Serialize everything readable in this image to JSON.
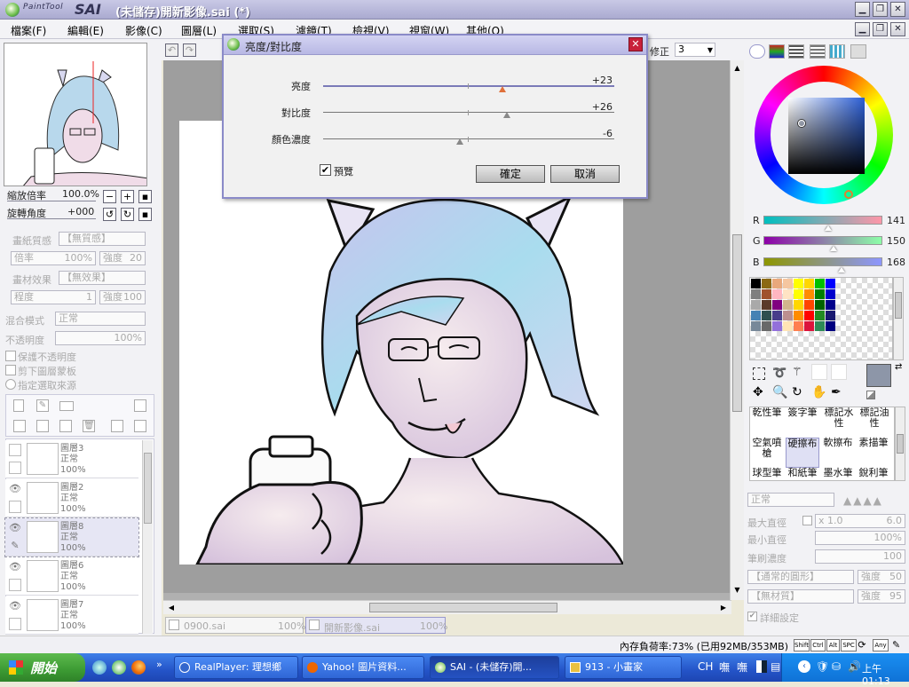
{
  "app": {
    "logo_text": "PaintTool",
    "logo_sai": "SAI",
    "window_title": "(未儲存)開新影像.sai (*)"
  },
  "menu": [
    "檔案(F)",
    "編輯(E)",
    "影像(C)",
    "圖層(L)",
    "選取(S)",
    "濾鏡(T)",
    "檢視(V)",
    "視窗(W)",
    "其他(O)"
  ],
  "toolbar": {
    "correction_label": "修正",
    "correction_value": "3"
  },
  "navigator": {
    "zoom_label": "縮放倍率",
    "zoom_value": "100.0%",
    "rotate_label": "旋轉角度",
    "rotate_value": "+000"
  },
  "paper": {
    "texture_label": "畫紙質感",
    "texture_value": "【無質感】",
    "scale_label": "倍率",
    "scale_value": "100%",
    "strength_label": "強度",
    "strength_value": "20",
    "effect_label": "畫材效果",
    "effect_value": "【無效果】",
    "degree_label": "程度",
    "degree_value": "1",
    "effect_strength_label": "強度",
    "effect_strength_value": "100"
  },
  "layer_props": {
    "blend_label": "混合模式",
    "blend_value": "正常",
    "opacity_label": "不透明度",
    "opacity_value": "100%",
    "preserve_opacity": "保護不透明度",
    "clip_group": "剪下圖層蒙板",
    "selection_source": "指定選取來源"
  },
  "layers": [
    {
      "name": "圖層3",
      "mode": "正常",
      "opacity": "100%"
    },
    {
      "name": "圖層2",
      "mode": "正常",
      "opacity": "100%"
    },
    {
      "name": "圖層8",
      "mode": "正常",
      "opacity": "100%"
    },
    {
      "name": "圖層6",
      "mode": "正常",
      "opacity": "100%"
    },
    {
      "name": "圖層7",
      "mode": "正常",
      "opacity": "100%"
    }
  ],
  "dialog": {
    "title": "亮度/對比度",
    "brightness_label": "亮度",
    "brightness_value": "+23",
    "brightness_level": 23,
    "contrast_label": "對比度",
    "contrast_value": "+26",
    "contrast_level": 26,
    "saturation_label": "顏色濃度",
    "saturation_value": "-6",
    "saturation_level": -6,
    "preview_label": "預覽",
    "preview_checked": true,
    "ok_label": "確定",
    "cancel_label": "取消"
  },
  "color": {
    "r_label": "R",
    "r_value": "141",
    "g_label": "G",
    "g_value": "150",
    "b_label": "B",
    "b_value": "168",
    "current_color": "#8d96a8"
  },
  "palette": [
    "#000000",
    "#8b6914",
    "#e8a87c",
    "#f5c6a0",
    "#ffff00",
    "#ffd700",
    "#00c000",
    "#0000ff",
    "#7f7f7f",
    "#a0522d",
    "#ffb6c1",
    "#ffe4c4",
    "#ffff00",
    "#ff8c00",
    "#008000",
    "#0000cd",
    "#a9a9a9",
    "#5b3a29",
    "#800080",
    "#d2b48c",
    "#ffd700",
    "#ff4500",
    "#006400",
    "#00008b",
    "#4682b4",
    "#2f4f4f",
    "#483d8b",
    "#bc8f8f",
    "#ff8c00",
    "#ff0000",
    "#228b22",
    "#191970",
    "#778899",
    "#696969",
    "#9370db",
    "#ffe4b5",
    "#ff7f50",
    "#dc143c",
    "#2e8b57",
    "#000080"
  ],
  "tools": [
    {
      "label": "乾性筆"
    },
    {
      "label": "簽字筆"
    },
    {
      "label": "標記水性"
    },
    {
      "label": "標記油性"
    },
    {
      "label": "空氣噴槍"
    },
    {
      "label": "硬擦布"
    },
    {
      "label": "軟擦布"
    },
    {
      "label": "素描筆"
    },
    {
      "label": "球型筆"
    },
    {
      "label": "和紙筆"
    },
    {
      "label": "墨水筆"
    },
    {
      "label": "銳利筆"
    }
  ],
  "brush": {
    "mode_value": "正常",
    "max_size_label": "最大直徑",
    "max_size_mult": "x 1.0",
    "max_size_value": "6.0",
    "min_size_label": "最小直徑",
    "min_size_value": "100%",
    "density_label": "筆刷濃度",
    "density_value": "100",
    "shape_value": "【通常的圓形】",
    "shape_strength_label": "強度",
    "shape_strength_value": "50",
    "texture_value": "【無材質】",
    "texture_strength_label": "強度",
    "texture_strength_value": "95",
    "detail_label": "詳細設定"
  },
  "docs": [
    {
      "name": "0900.sai",
      "zoom": "100%"
    },
    {
      "name": "開新影像.sai",
      "zoom": "100%"
    }
  ],
  "status": {
    "memory": "內存負荷率:73% (已用92MB/353MB)",
    "keys": [
      "Shift",
      "Ctrl",
      "Alt",
      "SPC",
      "Any"
    ]
  },
  "taskbar": {
    "start_label": "開始",
    "tasks": [
      "RealPlayer: 理想鄉",
      "Yahoo! 圖片資料...",
      "SAI - (未儲存)開...",
      "913 - 小畫家"
    ],
    "lang": "CH",
    "clock": "上午 01:13"
  }
}
